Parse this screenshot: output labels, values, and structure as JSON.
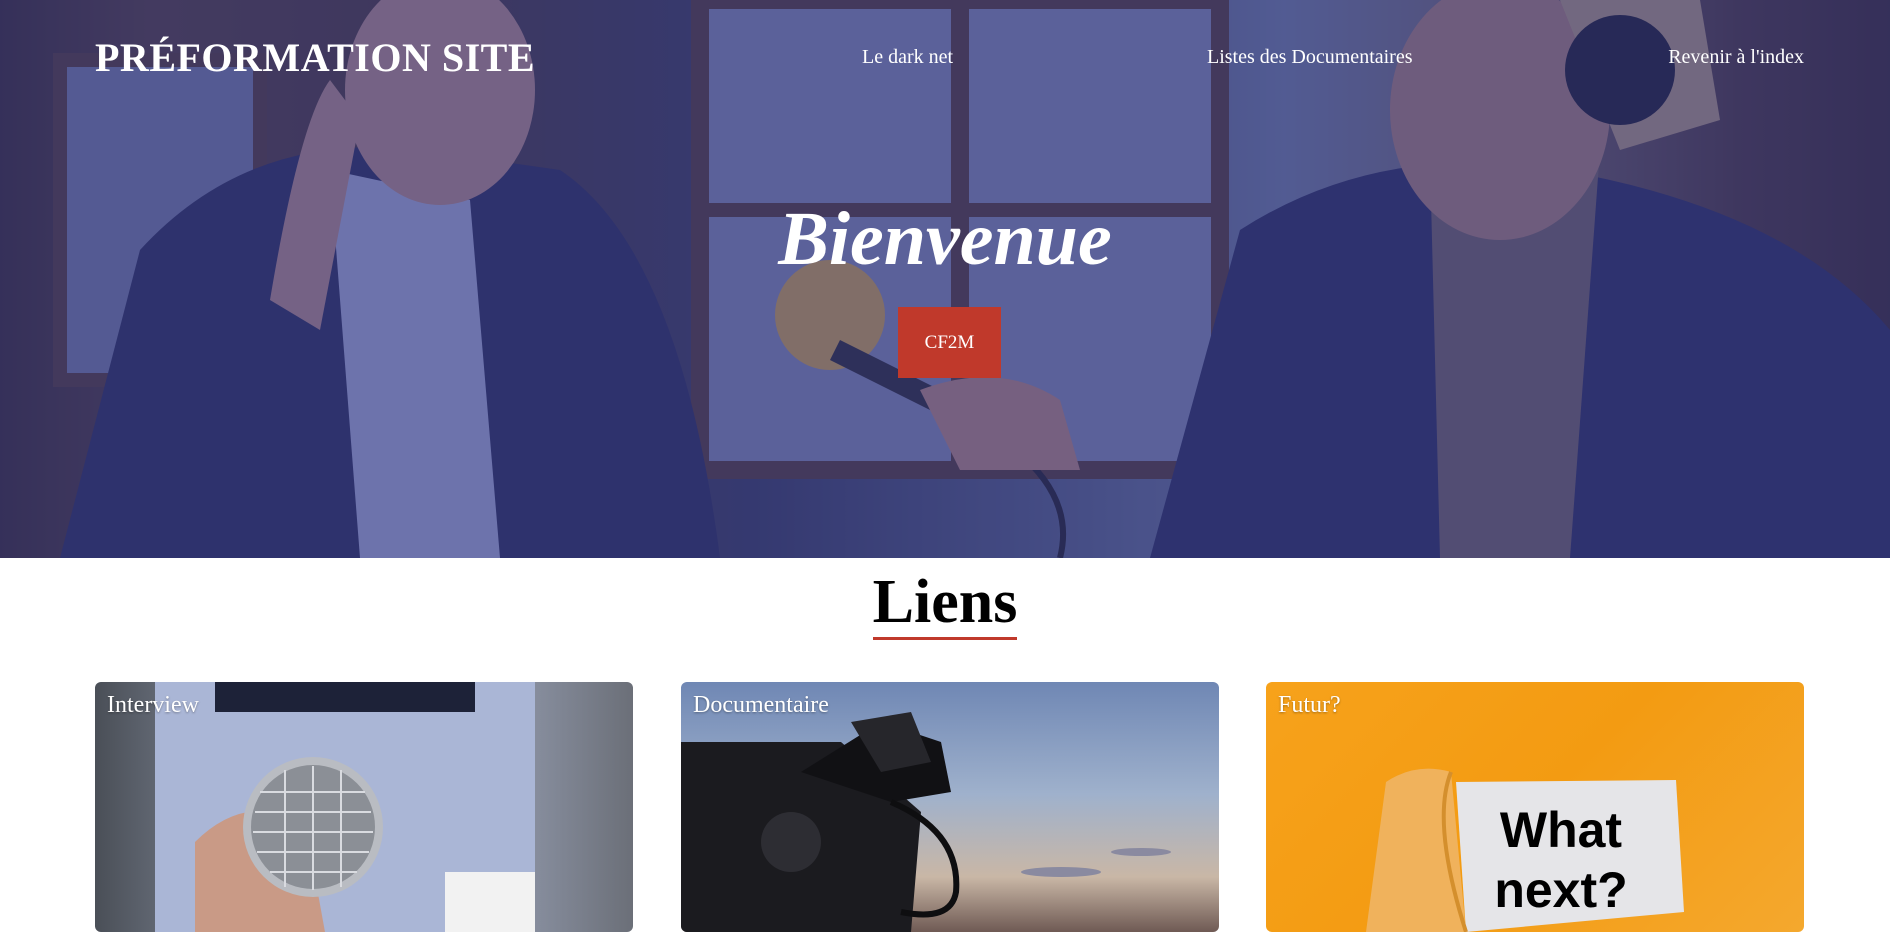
{
  "nav": {
    "brand": "PRÉFORMATION SITE",
    "links": [
      "Le dark net",
      "Listes des Documentaires",
      "Revenir à l'index"
    ]
  },
  "hero": {
    "title": "Bienvenue",
    "button_label": "CF2M",
    "overlay_color": "#323482",
    "button_color": "#c0392b"
  },
  "section": {
    "title": "Liens",
    "underline_color": "#c0392b"
  },
  "cards": [
    {
      "label": "Interview",
      "image": "microphone-photo"
    },
    {
      "label": "Documentaire",
      "image": "video-camera-photo"
    },
    {
      "label": "Futur?",
      "image": "what-next-paper-photo",
      "image_text": "What next?"
    }
  ]
}
